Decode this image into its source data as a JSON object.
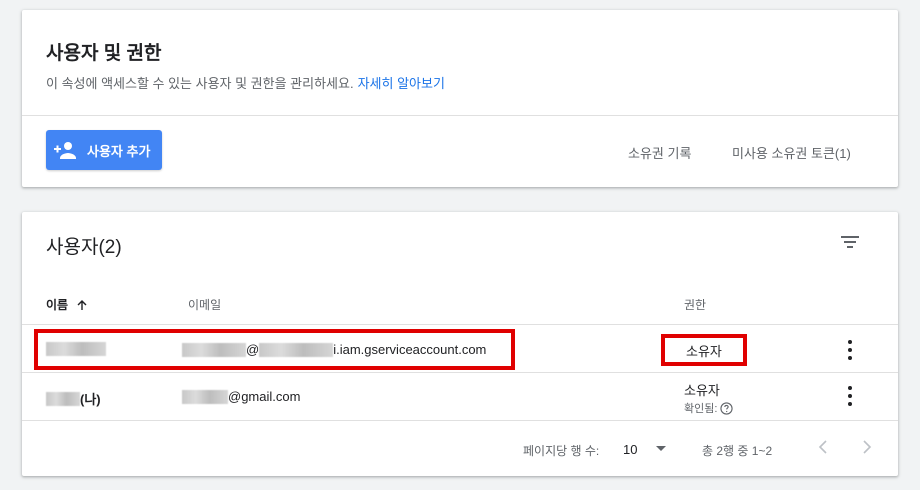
{
  "header_card": {
    "title": "사용자 및 권한",
    "description": "이 속성에 액세스할 수 있는 사용자 및 권한을 관리하세요.",
    "learn_more": "자세히 알아보기",
    "add_user_label": "사용자 추가",
    "ownership_history": "소유권 기록",
    "unused_tokens": "미사용 소유권 토큰(1)"
  },
  "users_card": {
    "title": "사용자(2)",
    "columns": {
      "name": "이름",
      "email": "이메일",
      "role": "권한"
    },
    "rows": [
      {
        "name": "",
        "email_suffix": "i.iam.gserviceaccount.com",
        "email_at": "@",
        "role": "소유자",
        "status": ""
      },
      {
        "name_suffix": "(나)",
        "email_suffix": "@gmail.com",
        "role": "소유자",
        "status": "확인됨:"
      }
    ],
    "pagination": {
      "rows_per_page_label": "페이지당 행 수:",
      "rows_per_page_value": "10",
      "range": "총 2행 중 1~2"
    }
  },
  "colors": {
    "primary": "#4285f4",
    "link": "#1a73e8",
    "highlight": "#e00000"
  },
  "icons": [
    "add-person-icon",
    "filter-icon",
    "sort-arrow-up-icon",
    "more-vert-icon",
    "help-icon",
    "dropdown-arrow-icon",
    "chevron-left-icon",
    "chevron-right-icon"
  ]
}
